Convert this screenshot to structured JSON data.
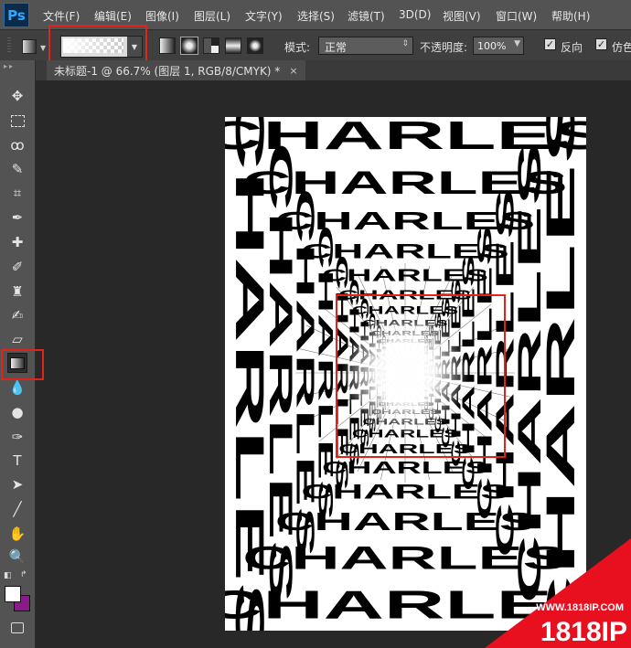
{
  "app": {
    "logo": "Ps"
  },
  "menu": [
    "文件(F)",
    "编辑(E)",
    "图像(I)",
    "图层(L)",
    "文字(Y)",
    "选择(S)",
    "滤镜(T)",
    "3D(D)",
    "视图(V)",
    "窗口(W)",
    "帮助(H)"
  ],
  "options": {
    "mode_label": "模式:",
    "mode_value": "正常",
    "opacity_label": "不透明度:",
    "opacity_value": "100%",
    "reverse_label": "反向",
    "dither_label": "仿色",
    "reverse_checked": true,
    "dither_checked": true
  },
  "document_tab": {
    "title": "未标题-1 @ 66.7% (图层 1, RGB/8/CMYK) *",
    "close": "×"
  },
  "canvas": {
    "repeated_word": "CHARLES"
  },
  "colors": {
    "foreground": "#ffffff",
    "background": "#8a1a8a",
    "highlight": "#e2231a"
  },
  "watermark": {
    "url": "WWW.1818IP.COM",
    "brand": "1818IP"
  }
}
